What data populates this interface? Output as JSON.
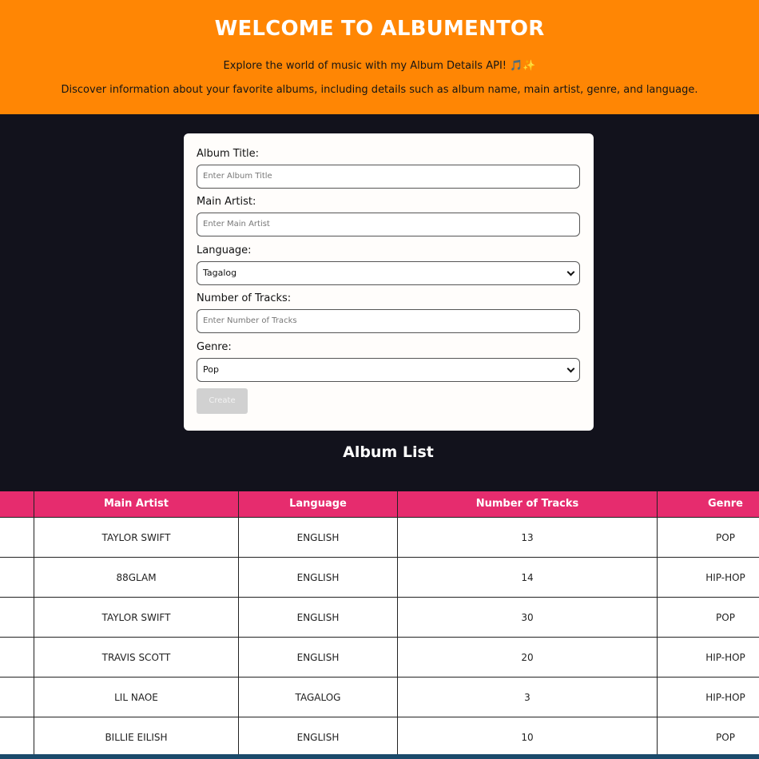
{
  "header": {
    "title": "WELCOME TO ALBUMENTOR",
    "subtitle": "Explore the world of music with my Album Details API! 🎵✨",
    "description": "Discover information about your favorite albums, including details such as album name, main artist, genre, and language."
  },
  "form": {
    "album_title_label": "Album Title:",
    "album_title_placeholder": "Enter Album Title",
    "main_artist_label": "Main Artist:",
    "main_artist_placeholder": "Enter Main Artist",
    "language_label": "Language:",
    "language_value": "Tagalog",
    "tracks_label": "Number of Tracks:",
    "tracks_placeholder": "Enter Number of Tracks",
    "genre_label": "Genre:",
    "genre_value": "Pop",
    "create_label": "Create"
  },
  "list": {
    "title": "Album List",
    "columns": [
      "Main Artist",
      "Language",
      "Number of Tracks",
      "Genre"
    ],
    "rows": [
      {
        "artist": "TAYLOR SWIFT",
        "language": "ENGLISH",
        "tracks": "13",
        "genre": "POP"
      },
      {
        "artist": "88GLAM",
        "language": "ENGLISH",
        "tracks": "14",
        "genre": "HIP-HOP"
      },
      {
        "artist": "TAYLOR SWIFT",
        "language": "ENGLISH",
        "tracks": "30",
        "genre": "POP"
      },
      {
        "artist": "TRAVIS SCOTT",
        "language": "ENGLISH",
        "tracks": "20",
        "genre": "HIP-HOP"
      },
      {
        "artist": "LIL NAOE",
        "language": "TAGALOG",
        "tracks": "3",
        "genre": "HIP-HOP"
      },
      {
        "artist": "BILLIE EILISH",
        "language": "ENGLISH",
        "tracks": "10",
        "genre": "POP"
      }
    ]
  },
  "colors": {
    "header_bg": "#ff8604",
    "page_bg": "#12121c",
    "table_header_bg": "#e62c6e"
  }
}
